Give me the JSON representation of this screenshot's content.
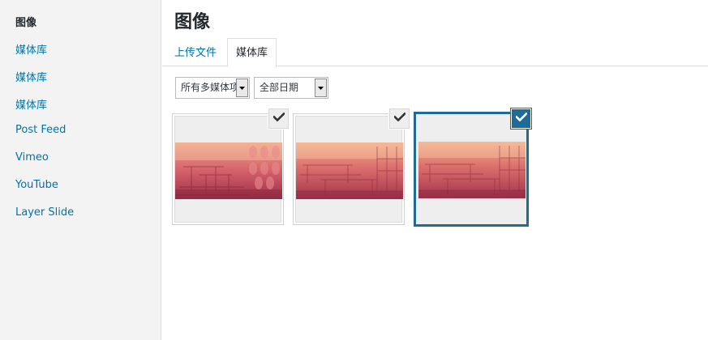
{
  "sidebar": {
    "title": "图像",
    "items": [
      {
        "label": "媒体库"
      },
      {
        "label": "媒体库"
      },
      {
        "label": "媒体库"
      },
      {
        "label": "Post Feed"
      },
      {
        "label": "Vimeo"
      },
      {
        "label": "YouTube"
      },
      {
        "label": "Layer Slide"
      }
    ]
  },
  "main": {
    "title": "图像",
    "tabs": [
      {
        "label": "上传文件",
        "active": false
      },
      {
        "label": "媒体库",
        "active": true
      }
    ],
    "filters": {
      "type": "所有多媒体项目",
      "date": "全部日期"
    },
    "attachments": [
      {
        "selected": false,
        "checked_icon": "checkmark-icon"
      },
      {
        "selected": false,
        "checked_icon": "checkmark-icon"
      },
      {
        "selected": true,
        "checked_icon": "checkmark-icon"
      }
    ]
  },
  "colors": {
    "link": "#0073aa",
    "selected_border": "#1e6b96",
    "sidebar_bg": "#f3f3f3"
  }
}
